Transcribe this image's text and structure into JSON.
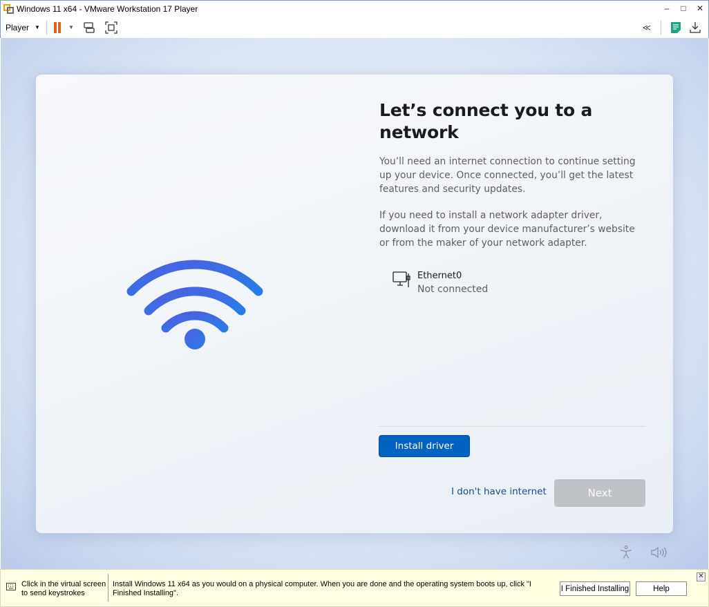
{
  "window": {
    "title": "Windows 11 x64 - VMware Workstation 17 Player",
    "controls": {
      "minimize": "–",
      "maximize": "□",
      "close": "✕"
    }
  },
  "toolbar": {
    "player_label": "Player",
    "caret": "▼",
    "icons": [
      "pause-icon",
      "send-ctrl-alt-del-icon",
      "fullscreen-icon",
      "collapse-icon",
      "notes-icon",
      "download-icon"
    ],
    "collapse_glyph": "≪"
  },
  "oobe": {
    "heading": "Let’s connect you to a network",
    "paragraph1": "You’ll need an internet connection to continue setting up your device. Once connected, you’ll get the latest features and security updates.",
    "paragraph2": "If you need to install a network adapter driver, download it from your device manufacturer’s website or from the maker of your network adapter.",
    "network": {
      "name": "Ethernet0",
      "status": "Not connected"
    },
    "install_driver_label": "Install driver",
    "no_internet_label": "I don't have internet",
    "next_label": "Next",
    "colors": {
      "accent": "#0063c1",
      "wifi_start": "#4d5fe0",
      "wifi_end": "#2a7de8"
    }
  },
  "hintbar": {
    "left_text": "Click in the virtual screen to send keystrokes",
    "main_text": "Install Windows 11 x64 as you would on a physical computer. When you are done and the operating system boots up, click \"I Finished Installing\".",
    "finished_label": "I Finished Installing",
    "help_label": "Help",
    "close_glyph": "✕"
  }
}
